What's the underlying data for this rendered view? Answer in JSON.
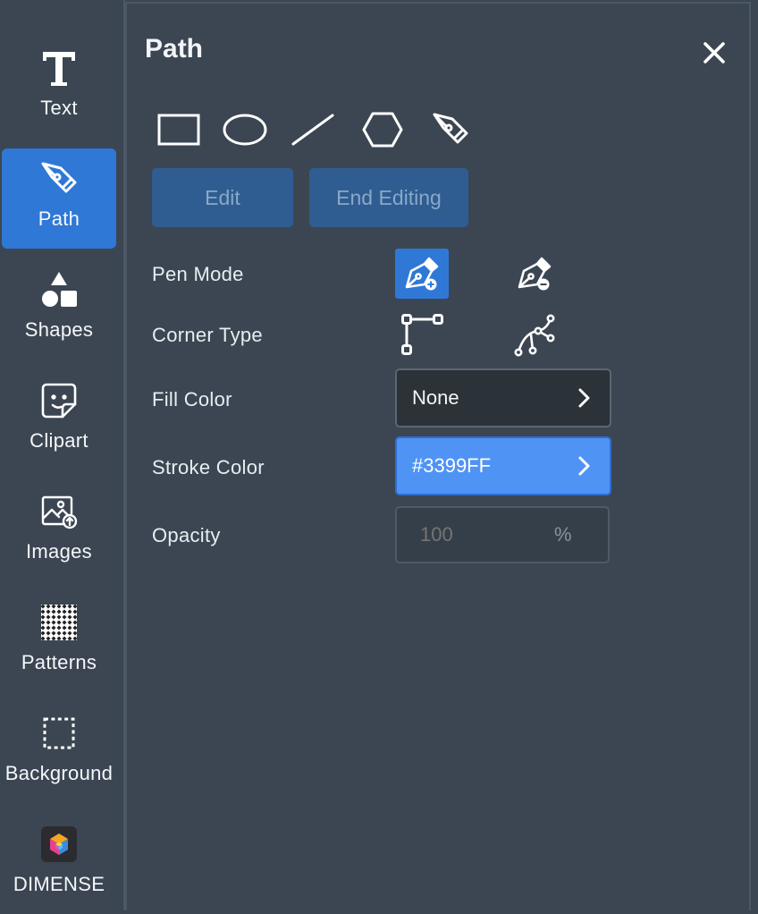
{
  "sidebar": {
    "items": [
      {
        "label": "Text",
        "icon": "text-icon",
        "active": false
      },
      {
        "label": "Path",
        "icon": "pen-tool-icon",
        "active": true
      },
      {
        "label": "Shapes",
        "icon": "shapes-icon",
        "active": false
      },
      {
        "label": "Clipart",
        "icon": "sticker-icon",
        "active": false
      },
      {
        "label": "Images",
        "icon": "image-upload-icon",
        "active": false
      },
      {
        "label": "Patterns",
        "icon": "pattern-icon",
        "active": false
      },
      {
        "label": "Background",
        "icon": "background-icon",
        "active": false
      },
      {
        "label": "DIMENSE",
        "icon": "dimense-logo-icon",
        "active": false
      }
    ]
  },
  "panel": {
    "title": "Path",
    "close_icon": "close-icon",
    "tools": [
      "rectangle-icon",
      "ellipse-icon",
      "line-icon",
      "hexagon-icon",
      "pen-tool-icon"
    ],
    "edit_label": "Edit",
    "end_editing_label": "End Editing",
    "pen_mode": {
      "label": "Pen Mode",
      "options": [
        "pen-add-icon",
        "pen-remove-icon"
      ],
      "selected": 0
    },
    "corner_type": {
      "label": "Corner Type",
      "options": [
        "corner-sharp-icon",
        "corner-curve-icon"
      ]
    },
    "fill_color": {
      "label": "Fill Color",
      "value": "None"
    },
    "stroke_color": {
      "label": "Stroke Color",
      "value": "#3399FF"
    },
    "opacity": {
      "label": "Opacity",
      "placeholder": "100",
      "unit": "%"
    }
  },
  "colors": {
    "background": "#3b4652",
    "accent": "#2f78d6",
    "stroke_swatch": "#4f93f5",
    "button": "#2f5d91"
  }
}
